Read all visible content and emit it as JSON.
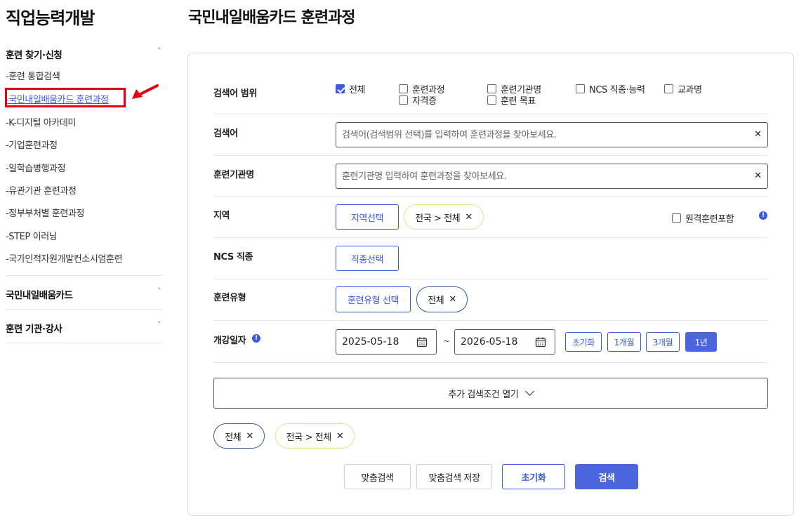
{
  "sidebar": {
    "title": "직업능력개발",
    "sections": [
      {
        "label": "훈련 찾기·신청",
        "chevron": "˄"
      },
      {
        "label": "국민내일배움카드",
        "chevron": "˅"
      },
      {
        "label": "훈련 기관·강사",
        "chevron": "˅"
      }
    ],
    "items": [
      {
        "label": "-훈련 통합검색"
      },
      {
        "label": "-국민내일배움카드 훈련과정"
      },
      {
        "label": "-K-디지털 아카데미"
      },
      {
        "label": "-기업훈련과정"
      },
      {
        "label": "-일학습병행과정"
      },
      {
        "label": "-유관기관 훈련과정"
      },
      {
        "label": "-정부부처별 훈련과정"
      },
      {
        "label": "-STEP 이러닝"
      },
      {
        "label": "-국가인적자원개발컨소시엄훈련"
      }
    ]
  },
  "main": {
    "title": "국민내일배움카드 훈련과정",
    "search_scope": {
      "label": "검색어 범위",
      "options": [
        {
          "label": "전체",
          "checked": true
        },
        {
          "label": "훈련과정",
          "checked": false
        },
        {
          "label": "훈련기관명",
          "checked": false
        },
        {
          "label": "NCS 직종·능력",
          "checked": false
        },
        {
          "label": "교과명",
          "checked": false
        },
        {
          "label": "자격증",
          "checked": false
        },
        {
          "label": "훈련 목표",
          "checked": false
        }
      ]
    },
    "keyword": {
      "label": "검색어",
      "value": "",
      "placeholder": "검색어(검색범위 선택)를 입력하여 훈련과정을 찾아보세요.",
      "clear": "✕"
    },
    "institution": {
      "label": "훈련기관명",
      "value": "",
      "placeholder": "훈련기관명 입력하여 훈련과정을 찾아보세요.",
      "clear": "✕"
    },
    "region": {
      "label": "지역",
      "button": "지역선택",
      "chip": "전국 > 전체",
      "remote_label": "원격훈련포함",
      "remote_checked": false
    },
    "ncs": {
      "label": "NCS 직종",
      "button": "직종선택"
    },
    "training_type": {
      "label": "훈련유형",
      "button": "훈련유형 선택",
      "chip": "전체"
    },
    "start_date": {
      "label": "개강일자",
      "from": "2025-05-18",
      "separator": "~",
      "to": "2026-05-18",
      "periods": [
        {
          "label": "초기화",
          "active": false
        },
        {
          "label": "1개월",
          "active": false
        },
        {
          "label": "3개월",
          "active": false
        },
        {
          "label": "1년",
          "active": true
        }
      ]
    },
    "more_toggle": "추가 검색조건 열기",
    "selected_chips": [
      {
        "label": "전체",
        "style": "blue"
      },
      {
        "label": "전국 > 전체",
        "style": "yellow"
      }
    ],
    "chip_remove": "✕",
    "info_glyph": "!",
    "actions": {
      "custom_search": "맞춤검색",
      "save_custom_search": "맞춤검색 저장",
      "reset": "초기화",
      "search": "검색"
    }
  },
  "colors": {
    "accent": "#4c64dc",
    "link": "#3b5bdb",
    "highlight_box": "#e60012",
    "chip_yellow": "#f2dd8a"
  }
}
